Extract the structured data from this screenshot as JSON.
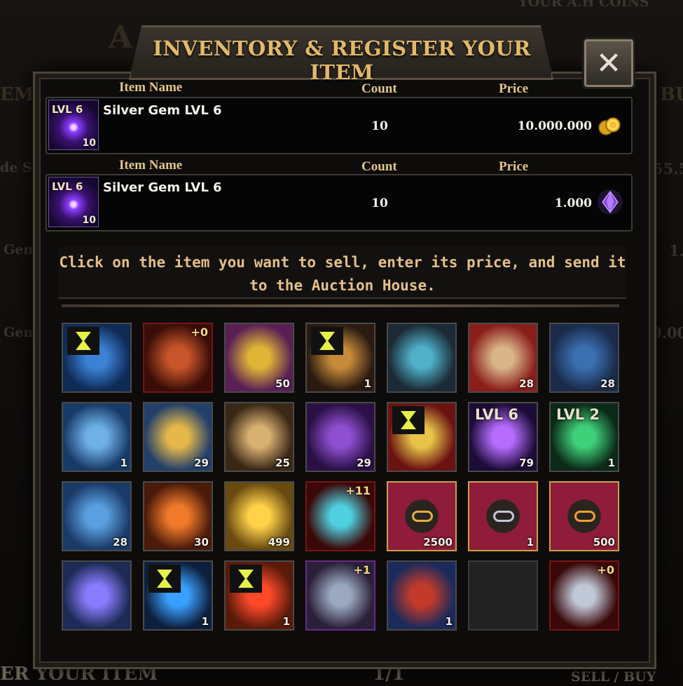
{
  "background": {
    "top_right_text": "YOUR A.H COINS",
    "left_frag_1": "EM",
    "left_frag_2": "de S",
    "left_frag_3": "Gen",
    "left_frag_4": "Gen",
    "right_frag_1": "BU",
    "right_frag_2": "55.5",
    "right_frag_3": "1.",
    "right_frag_4": "0.00",
    "bottom_left": "ER YOUR ITEM",
    "bottom_center": "1/1",
    "bottom_right": "SELL / BUY",
    "top_letter": "A"
  },
  "modal": {
    "title": "INVENTORY & REGISTER YOUR ITEM",
    "close_icon": "close-icon",
    "columns": {
      "name": "Item Name",
      "count": "Count",
      "price": "Price"
    },
    "listings": [
      {
        "name": "Silver Gem LVL 6",
        "level": "LVL 6",
        "stack": "10",
        "count": "10",
        "price": "10.000.000",
        "currency_icon": "gold-coins-icon"
      },
      {
        "name": "Silver Gem LVL 6",
        "level": "LVL 6",
        "stack": "10",
        "count": "10",
        "price": "1.000",
        "currency_icon": "purple-gem-icon"
      }
    ],
    "instruction": "Click on the item you want to sell, enter its price, and send it to the Auction House."
  },
  "inventory": [
    {
      "icon": "ice-phoenix-icon",
      "count": "",
      "badge": "",
      "lvl": "",
      "timer": true,
      "frame": "normal"
    },
    {
      "icon": "amulet-icon",
      "count": "",
      "badge": "+0",
      "lvl": "",
      "timer": false,
      "frame": "red"
    },
    {
      "icon": "sun-talisman-icon",
      "count": "50",
      "badge": "",
      "lvl": "",
      "timer": false,
      "frame": "normal"
    },
    {
      "icon": "magnifier-icon",
      "count": "1",
      "badge": "",
      "lvl": "",
      "timer": true,
      "frame": "normal"
    },
    {
      "icon": "portal-mirror-icon",
      "count": "",
      "badge": "",
      "lvl": "",
      "timer": false,
      "frame": "normal"
    },
    {
      "icon": "red-scroll-icon",
      "count": "28",
      "badge": "",
      "lvl": "",
      "timer": false,
      "frame": "normal"
    },
    {
      "icon": "shield-scroll-icon",
      "count": "28",
      "badge": "",
      "lvl": "",
      "timer": false,
      "frame": "normal"
    },
    {
      "icon": "ncs-scroll-icon",
      "count": "1",
      "badge": "",
      "lvl": "",
      "timer": false,
      "frame": "normal"
    },
    {
      "icon": "sprint-scroll-icon",
      "count": "29",
      "badge": "",
      "lvl": "",
      "timer": false,
      "frame": "normal"
    },
    {
      "icon": "swords-scroll-icon",
      "count": "25",
      "badge": "",
      "lvl": "",
      "timer": false,
      "frame": "normal"
    },
    {
      "icon": "lion-scroll-icon",
      "count": "29",
      "badge": "",
      "lvl": "",
      "timer": false,
      "frame": "normal"
    },
    {
      "icon": "gold-armor-icon",
      "count": "",
      "badge": "",
      "lvl": "",
      "timer": true,
      "frame": "normal"
    },
    {
      "icon": "purple-gem-orb-icon",
      "count": "79",
      "badge": "",
      "lvl": "LVL 6",
      "timer": false,
      "frame": "normal"
    },
    {
      "icon": "green-crystal-icon",
      "count": "1",
      "badge": "",
      "lvl": "LVL 2",
      "timer": false,
      "frame": "normal"
    },
    {
      "icon": "blue-shield-scroll-icon",
      "count": "28",
      "badge": "",
      "lvl": "",
      "timer": false,
      "frame": "normal"
    },
    {
      "icon": "dagger-scroll-icon",
      "count": "30",
      "badge": "",
      "lvl": "",
      "timer": false,
      "frame": "normal"
    },
    {
      "icon": "potion-icon",
      "count": "499",
      "badge": "",
      "lvl": "",
      "timer": false,
      "frame": "normal"
    },
    {
      "icon": "crystal-armor-icon",
      "count": "",
      "badge": "+11",
      "lvl": "",
      "timer": false,
      "frame": "red"
    },
    {
      "icon": "gold-bracelet-icon",
      "count": "2500",
      "badge": "",
      "lvl": "",
      "timer": false,
      "frame": "gold"
    },
    {
      "icon": "silver-bracelet-icon",
      "count": "1",
      "badge": "",
      "lvl": "",
      "timer": false,
      "frame": "gold"
    },
    {
      "icon": "gold-amulet-icon",
      "count": "500",
      "badge": "",
      "lvl": "",
      "timer": false,
      "frame": "gold"
    },
    {
      "icon": "spellbook-icon",
      "count": "",
      "badge": "",
      "lvl": "",
      "timer": false,
      "frame": "normal"
    },
    {
      "icon": "blue-star-emblem-icon",
      "count": "1",
      "badge": "",
      "lvl": "",
      "timer": true,
      "frame": "normal"
    },
    {
      "icon": "red-star-emblem-icon",
      "count": "1",
      "badge": "",
      "lvl": "",
      "timer": true,
      "frame": "normal"
    },
    {
      "icon": "chest-armor-icon",
      "count": "",
      "badge": "+1",
      "lvl": "",
      "timer": false,
      "frame": "purple"
    },
    {
      "icon": "orc-portrait-scroll-icon",
      "count": "1",
      "badge": "",
      "lvl": "",
      "timer": false,
      "frame": "normal"
    },
    {
      "icon": "empty-slot",
      "count": "",
      "badge": "",
      "lvl": "",
      "timer": false,
      "frame": "empty"
    },
    {
      "icon": "silver-bracelet-icon",
      "count": "",
      "badge": "+0",
      "lvl": "",
      "timer": false,
      "frame": "red"
    }
  ]
}
